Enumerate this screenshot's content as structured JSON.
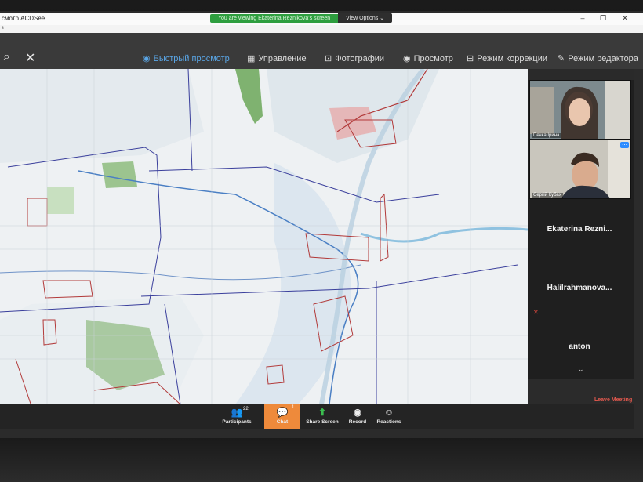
{
  "share_banner": {
    "viewing_text": "You are viewing Ekaterina Reznikova's screen",
    "options_label": "View Options ⌄"
  },
  "app": {
    "title": "смотр ACDSee",
    "sub": "з"
  },
  "toolbar": {
    "items": [
      {
        "label": "Быстрый просмотр",
        "icon": "eye-icon"
      },
      {
        "label": "Управление",
        "icon": "grid-icon"
      },
      {
        "label": "Фотографии",
        "icon": "photos-icon"
      },
      {
        "label": "Просмотр",
        "icon": "eye-icon"
      },
      {
        "label": "Режим коррекции",
        "icon": "adjust-icon"
      },
      {
        "label": "Режим редактора",
        "icon": "edit-icon"
      }
    ]
  },
  "participants_panel": {
    "video_1_name": "Печка Ірина",
    "video_2_name": "Сергій Кубах",
    "tiles": [
      "Ekaterina  Rezni...",
      "Halilrahmanova...",
      "anton"
    ]
  },
  "meeting_controls": {
    "participants_label": "Participants",
    "participants_count": "22",
    "chat_label": "Chat",
    "chat_badge": "1",
    "share_label": "Share Screen",
    "record_label": "Record",
    "reactions_label": "Reactions",
    "leave_label": "Leave Meeting"
  },
  "colors": {
    "share_green": "#2e9e3f",
    "active_blue": "#5aa6e6",
    "chat_orange": "#ee8a3b",
    "leave_red": "#e85a4f",
    "map_boundary": "#3a3f9c",
    "map_parcel_red": "#b23a3a"
  }
}
